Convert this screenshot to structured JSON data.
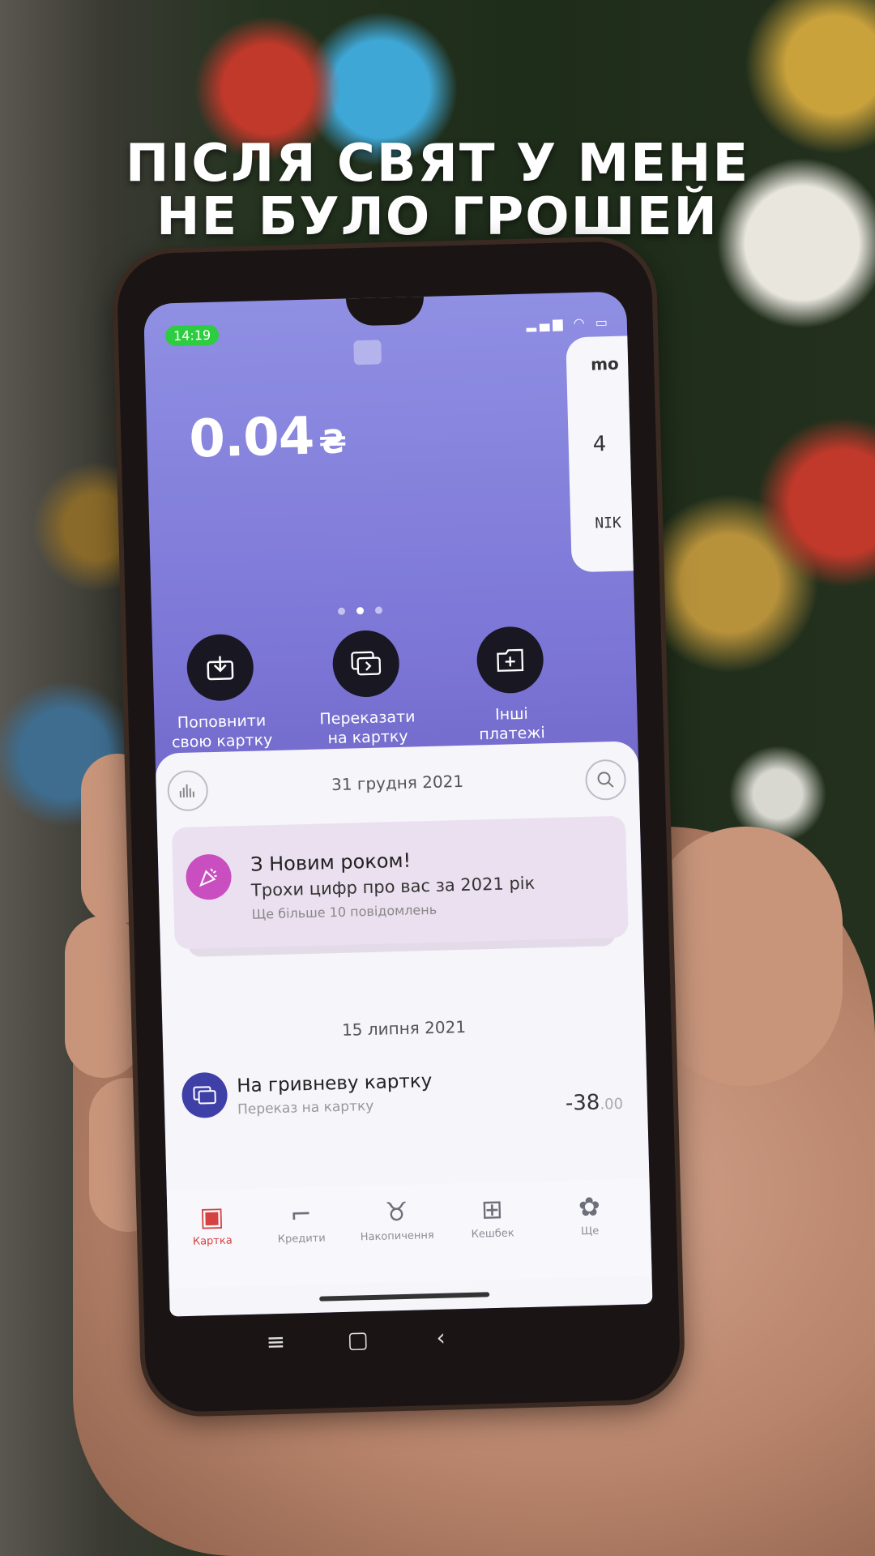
{
  "caption": {
    "line1": "ПІСЛЯ СВЯТ У МЕНЕ",
    "line2": "НЕ БУЛО ГРОШЕЙ"
  },
  "status_bar": {
    "time": "14:19",
    "icons": [
      "signal-icon",
      "wifi-icon",
      "battery-icon"
    ]
  },
  "balance": {
    "amount": "0.04",
    "currency": "₴"
  },
  "card_peek": {
    "brand_fragment": "mo",
    "number_fragment": "4",
    "name_fragment": "NIK"
  },
  "actions": [
    {
      "label_line1": "Поповнити",
      "label_line2": "свою картку",
      "icon": "download-icon"
    },
    {
      "label_line1": "Переказати",
      "label_line2": "на картку",
      "icon": "transfer-card-icon"
    },
    {
      "label_line1": "Інші",
      "label_line2": "платежі",
      "icon": "add-payment-icon"
    }
  ],
  "feed": {
    "date1": "31 грудня 2021",
    "promo": {
      "title": "З Новим роком!",
      "subtitle": "Трохи цифр про вас за 2021 рік",
      "note": "Ще більше 10 повідомлень"
    },
    "date2": "15 липня 2021",
    "transaction": {
      "title": "На гривневу картку",
      "subtitle": "Переказ на картку",
      "amount": "-38",
      "cents": ".00"
    }
  },
  "tabs": [
    {
      "label": "Картка",
      "icon": "card-icon"
    },
    {
      "label": "Кредити",
      "icon": "sock-icon"
    },
    {
      "label": "Накопичення",
      "icon": "money-bag-icon"
    },
    {
      "label": "Кешбек",
      "icon": "gift-icon"
    },
    {
      "label": "Ще",
      "icon": "more-icon"
    }
  ],
  "colors": {
    "header_gradient_top": "#8f8fe3",
    "header_gradient_bottom": "#6e63c4",
    "active_tab": "#d64141",
    "clock_pill": "#2ecc40",
    "promo_avatar": "#c94fc0"
  }
}
